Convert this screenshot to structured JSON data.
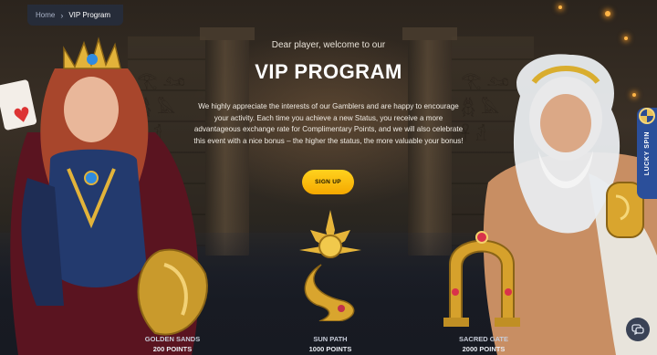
{
  "breadcrumb": {
    "home": "Home",
    "separator": "›",
    "current": "VIP Program"
  },
  "hero": {
    "welcome": "Dear player, welcome to our",
    "title": "VIP PROGRAM",
    "description": "We highly appreciate the interests of our Gamblers and are happy to encourage your activity. Each time you achieve a new Status, you receive a more advantageous exchange rate for Complimentary Points, and we will also celebrate this event with a nice bonus – the higher the status, the more valuable your bonus!",
    "signup_label": "SIGN UP"
  },
  "levels": [
    {
      "name": "GOLDEN SANDS",
      "points": "200 POINTS"
    },
    {
      "name": "SUN PATH",
      "points": "1000 POINTS"
    },
    {
      "name": "SACRED GATE",
      "points": "2000 POINTS"
    }
  ],
  "side_tab": {
    "label": "LUCKY SPIN"
  },
  "icons": {
    "chat": "chat-icon",
    "wheel": "wheel-icon"
  },
  "colors": {
    "accent": "#FFC107",
    "tab": "#2B4F9A",
    "breadcrumb_bg": "#262C3C"
  }
}
